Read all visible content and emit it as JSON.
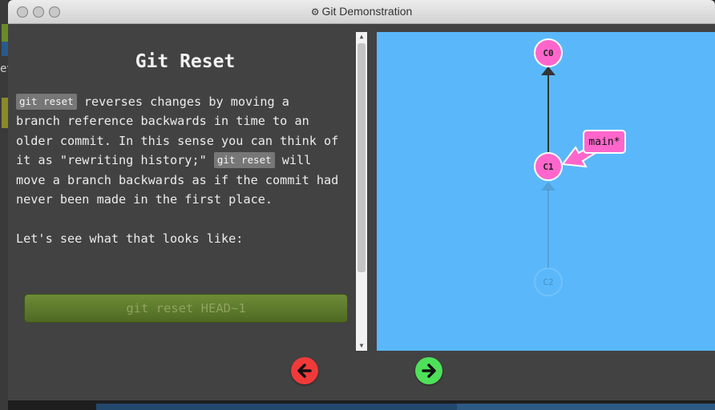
{
  "window": {
    "title": "Git Demonstration",
    "title_icon": "gear-icon"
  },
  "background": {
    "cut_text": "ev"
  },
  "lesson": {
    "heading": "Git Reset",
    "code_inline_1": "git reset",
    "line1": " reverses changes by moving a",
    "line2": "branch reference backwards in time to an",
    "line3": "older commit. In this sense you can think of",
    "line4_a": "it as \"rewriting history;\" ",
    "code_inline_2": "git reset",
    "line4_b": " will",
    "line5": "move a branch backwards as if the commit had",
    "line6": "never been made in the first place.",
    "line8": "Let's see what that looks like:",
    "command_button": "git reset HEAD~1"
  },
  "graph": {
    "commits": [
      {
        "id": "C0",
        "state": "active"
      },
      {
        "id": "C1",
        "state": "active"
      },
      {
        "id": "C2",
        "state": "faded"
      }
    ],
    "branch_label": "main*",
    "branch_target": "C1",
    "colors": {
      "canvas": "#5ab8fa",
      "commit": "#ff66cc",
      "branch": "#ff66cc",
      "edge": "#333333"
    }
  },
  "nav": {
    "prev_icon": "arrow-left-icon",
    "next_icon": "arrow-right-icon",
    "prev_color": "#f03a3a",
    "next_color": "#4fe05a"
  }
}
